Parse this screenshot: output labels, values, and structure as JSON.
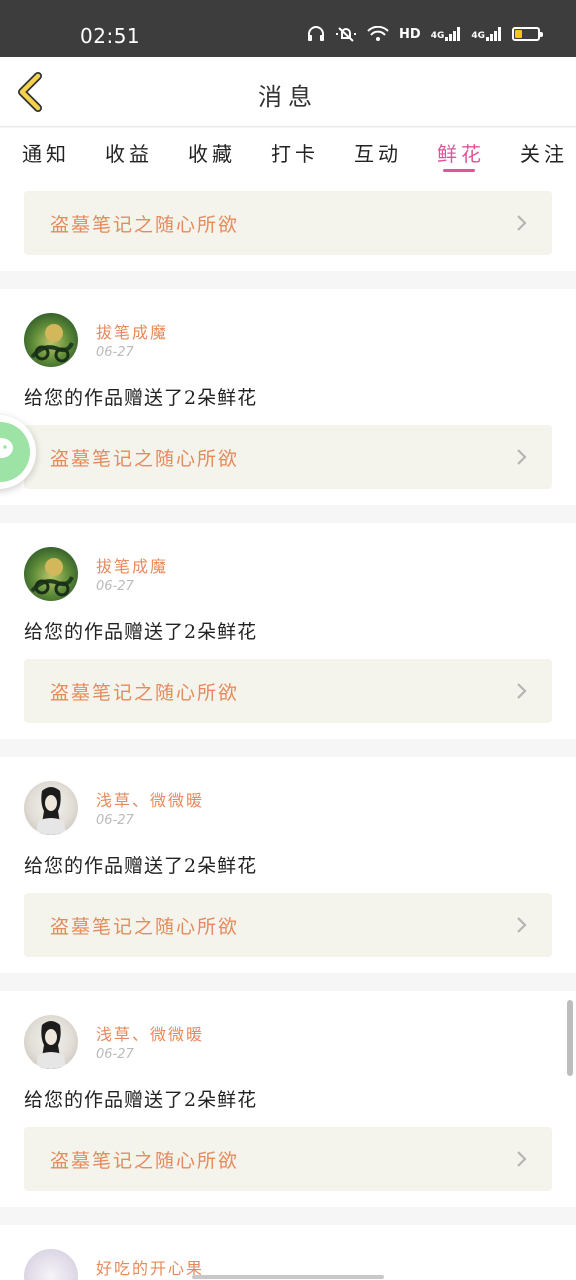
{
  "status_bar": {
    "time": "02:51",
    "hd_label": "HD",
    "network_1": "4G",
    "network_2": "4G"
  },
  "header": {
    "title": "消息"
  },
  "tabs": [
    {
      "label": "通知",
      "active": false
    },
    {
      "label": "收益",
      "active": false
    },
    {
      "label": "收藏",
      "active": false
    },
    {
      "label": "打卡",
      "active": false
    },
    {
      "label": "互动",
      "active": false
    },
    {
      "label": "鲜花",
      "active": true
    },
    {
      "label": "关注",
      "active": false
    }
  ],
  "first_card": {
    "work_title": "盗墓笔记之随心所欲"
  },
  "cards": [
    {
      "username": "拔笔成魔",
      "date": "06-27",
      "message": "给您的作品赠送了2朵鲜花",
      "work_title": "盗墓笔记之随心所欲",
      "avatar": "green"
    },
    {
      "username": "拔笔成魔",
      "date": "06-27",
      "message": "给您的作品赠送了2朵鲜花",
      "work_title": "盗墓笔记之随心所欲",
      "avatar": "green"
    },
    {
      "username": "浅草、微微暖",
      "date": "06-27",
      "message": "给您的作品赠送了2朵鲜花",
      "work_title": "盗墓笔记之随心所欲",
      "avatar": "ink"
    },
    {
      "username": "浅草、微微暖",
      "date": "06-27",
      "message": "给您的作品赠送了2朵鲜花",
      "work_title": "盗墓笔记之随心所欲",
      "avatar": "ink"
    }
  ],
  "partial_card": {
    "username": "好吃的开心果"
  },
  "icons": {
    "back": "chevron-left-icon",
    "wechat": "wechat-icon",
    "chevron": "chevron-right-icon"
  },
  "colors": {
    "accent_pink": "#e1549a",
    "accent_orange": "#e68a5c",
    "back_yellow": "#f5d24c"
  }
}
